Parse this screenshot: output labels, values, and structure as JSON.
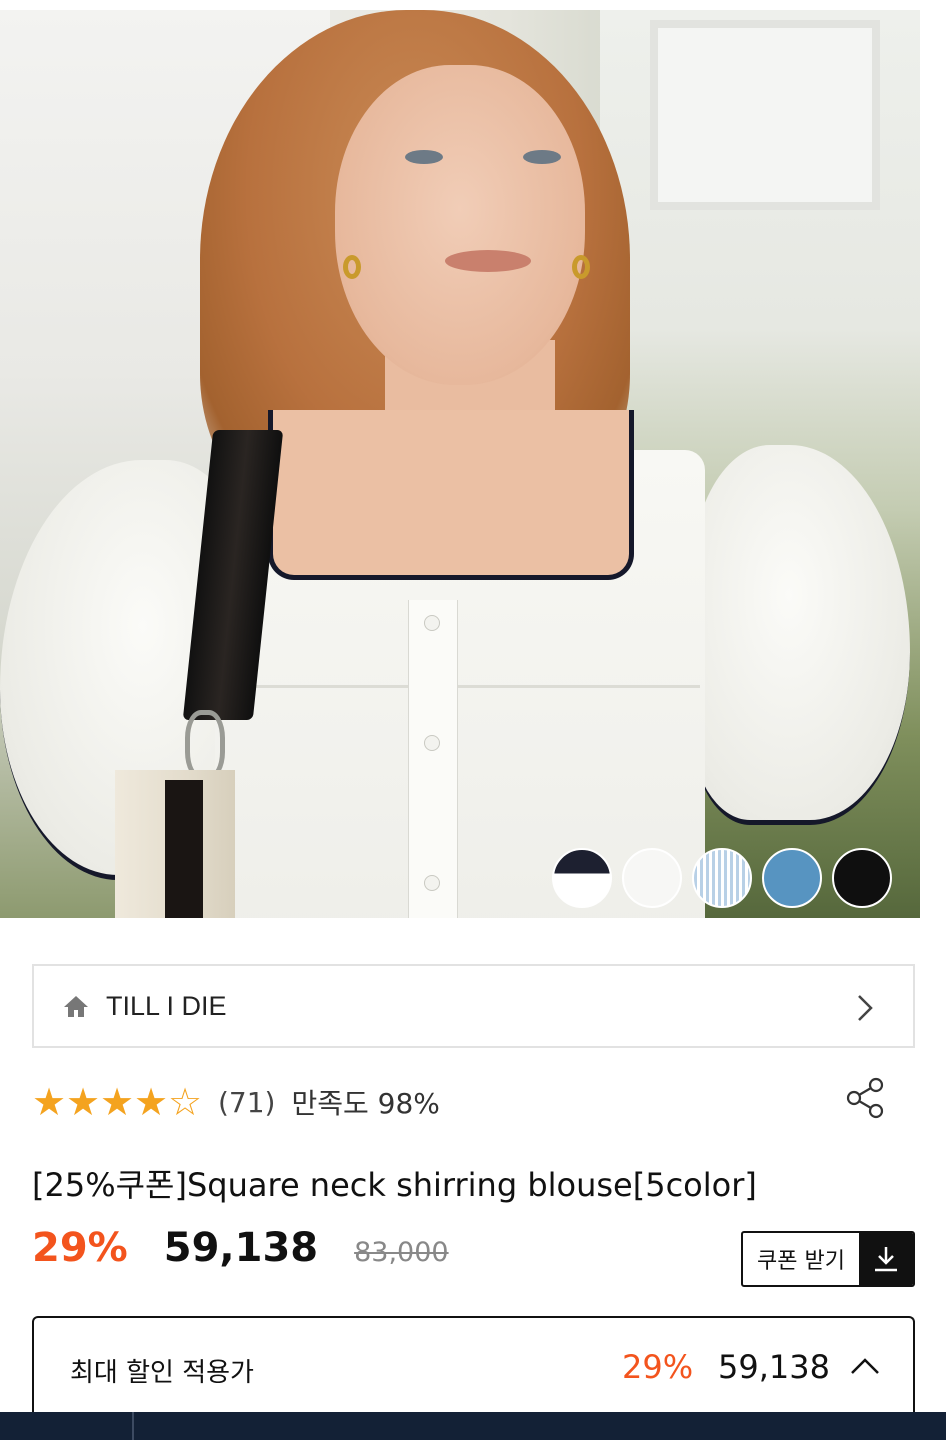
{
  "hero": {
    "alt": "product-model-photo",
    "swatches": [
      {
        "name": "navy-white",
        "color": "#1d2030"
      },
      {
        "name": "white",
        "color": "#f7f7f5"
      },
      {
        "name": "blue-stripe",
        "color": "#b8d0e6"
      },
      {
        "name": "blue",
        "color": "#5794c1"
      },
      {
        "name": "black",
        "color": "#0f0f0f"
      }
    ]
  },
  "brand": {
    "icon": "home-icon",
    "name": "TILL I DIE",
    "chevron": "chevron-right-icon"
  },
  "rating": {
    "stars": [
      "★",
      "★",
      "★",
      "★",
      "☆"
    ],
    "value": 4,
    "max": 5,
    "review_count": "(71)",
    "satisfaction": "만족도 98%"
  },
  "product": {
    "title": "[25%쿠폰]Square neck shirring blouse[5color]",
    "discount": "29%",
    "sale_price": "59,138",
    "original_price": "83,000"
  },
  "coupon": {
    "label": "쿠폰 받기",
    "icon": "download-icon"
  },
  "max_discount": {
    "label": "최대 할인 적용가",
    "discount": "29%",
    "price": "59,138",
    "icon": "chevron-up-icon"
  },
  "colors": {
    "accent": "#f3541d",
    "star": "#f4a31f",
    "bottom_bar": "#132136"
  }
}
